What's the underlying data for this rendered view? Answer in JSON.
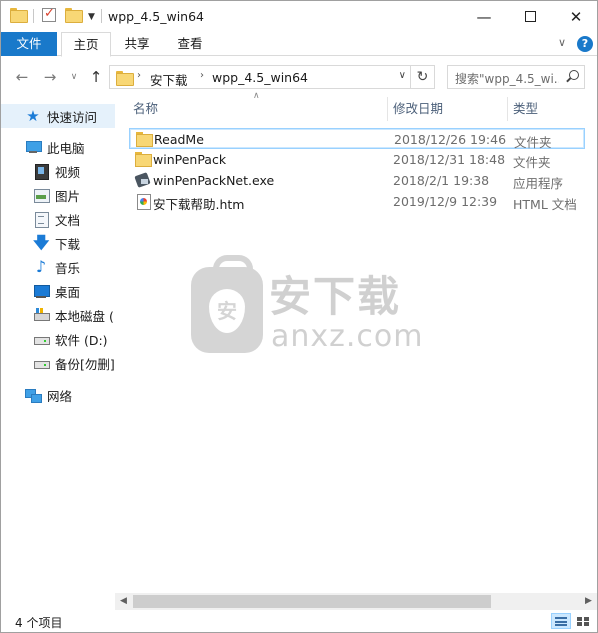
{
  "window": {
    "title": "wpp_4.5_win64"
  },
  "ribbon": {
    "tabs": [
      {
        "label": "文件"
      },
      {
        "label": "主页"
      },
      {
        "label": "共享"
      },
      {
        "label": "查看"
      }
    ]
  },
  "address": {
    "path": [
      "安下载",
      "wpp_4.5_win64"
    ],
    "search_placeholder": "搜索\"wpp_4.5_wi..."
  },
  "nav_pane": {
    "items": [
      {
        "label": "快速访问",
        "icon": "star-icon",
        "selected": true
      },
      {
        "label": "此电脑",
        "icon": "computer-icon"
      },
      {
        "label": "视频",
        "icon": "video-icon"
      },
      {
        "label": "图片",
        "icon": "picture-icon"
      },
      {
        "label": "文档",
        "icon": "document-icon"
      },
      {
        "label": "下载",
        "icon": "download-icon"
      },
      {
        "label": "音乐",
        "icon": "music-icon"
      },
      {
        "label": "桌面",
        "icon": "desktop-icon"
      },
      {
        "label": "本地磁盘 (",
        "icon": "local-disk-icon"
      },
      {
        "label": "软件 (D:)",
        "icon": "drive-icon"
      },
      {
        "label": "备份[勿删]",
        "icon": "drive-icon"
      },
      {
        "label": "网络",
        "icon": "network-icon"
      }
    ]
  },
  "file_list": {
    "columns": {
      "name": "名称",
      "date": "修改日期",
      "type": "类型"
    },
    "rows": [
      {
        "name": "ReadMe",
        "date": "2018/12/26 19:46",
        "type": "文件夹",
        "icon": "folder-icon",
        "selected": true
      },
      {
        "name": "winPenPack",
        "date": "2018/12/31 18:48",
        "type": "文件夹",
        "icon": "folder-icon"
      },
      {
        "name": "winPenPackNet.exe",
        "date": "2018/2/1 19:38",
        "type": "应用程序",
        "icon": "exe-icon"
      },
      {
        "name": "安下载帮助.htm",
        "date": "2019/12/9 12:39",
        "type": "HTML 文档",
        "icon": "html-file-icon"
      }
    ]
  },
  "watermark": {
    "big": "安下载",
    "small": "anxz.com",
    "badge": "安"
  },
  "status": {
    "item_count": "4 个项目"
  },
  "colors": {
    "accent": "#1979ca",
    "selection_border": "#99d1ff",
    "header_text": "#4c607a"
  }
}
